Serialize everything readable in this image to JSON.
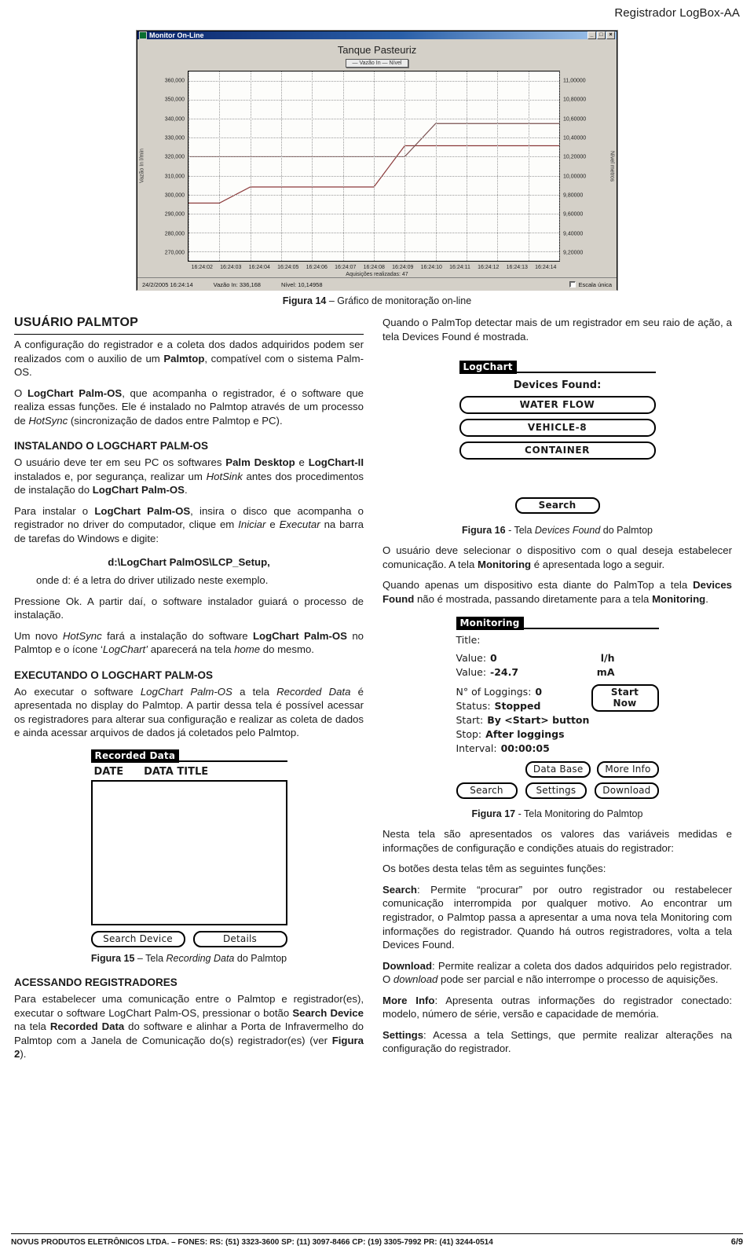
{
  "header": {
    "title": "Registrador LogBox-AA"
  },
  "window": {
    "title": "Monitor On-Line",
    "buttons": {
      "minimize": "_",
      "maximize": "□",
      "close": "×"
    },
    "chart_title": "Tanque Pasteuriz",
    "legend": "— Vazão In — Nível",
    "acquisitions": "Aquisições realizadas: 47",
    "status": {
      "datetime": "24/2/2005 16:24:14",
      "vazao": "Vazão In: 336,168",
      "nivel": "Nível: 10,14958",
      "checkbox_label": "Escala única"
    }
  },
  "chart_data": {
    "type": "line",
    "title": "Tanque Pasteuriz",
    "xlabel": "",
    "ylabel": "Vazão In l/min",
    "y2label": "Nível metros",
    "legend": [
      "Vazão In",
      "Nível"
    ],
    "legend_position": "top-center",
    "grid": true,
    "ylim": [
      265000,
      365000
    ],
    "y2lim": [
      9.1,
      11.1
    ],
    "yticks": [
      "360,000",
      "350,000",
      "340,000",
      "330,000",
      "320,000",
      "310,000",
      "300,000",
      "290,000",
      "280,000",
      "270,000"
    ],
    "ytick_values": [
      360000,
      350000,
      340000,
      330000,
      320000,
      310000,
      300000,
      290000,
      280000,
      270000
    ],
    "y2ticks": [
      "11,00000",
      "10,80000",
      "10,60000",
      "10,40000",
      "10,20000",
      "10,00000",
      "9,80000",
      "9,60000",
      "9,40000",
      "9,20000"
    ],
    "y2tick_values": [
      11.0,
      10.8,
      10.6,
      10.4,
      10.2,
      10.0,
      9.8,
      9.6,
      9.4,
      9.2
    ],
    "x": [
      "16:24:02",
      "16:24:03",
      "16:24:04",
      "16:24:05",
      "16:24:06",
      "16:24:07",
      "16:24:08",
      "16:24:09",
      "16:24:10",
      "16:24:11",
      "16:24:12",
      "16:24:13",
      "16:24:14"
    ],
    "series": [
      {
        "name": "Vazão In",
        "axis": "left",
        "color": "#8b3a3a",
        "values": [
          295500,
          295500,
          304000,
          304000,
          304000,
          304000,
          304000,
          325800,
          325800,
          325800,
          325800,
          325800,
          325800
        ]
      },
      {
        "name": "Nível",
        "axis": "right",
        "color": "#7a5050",
        "values": [
          10.2,
          10.2,
          10.2,
          10.2,
          10.2,
          10.2,
          10.2,
          10.2,
          10.55,
          10.55,
          10.55,
          10.55,
          10.55
        ]
      }
    ]
  },
  "captions": {
    "fig14": {
      "bold": "Figura 14",
      "rest": " – Gráfico de monitoração on-line"
    },
    "fig15": {
      "bold": "Figura 15",
      "rest": " – Tela Recording Data do Palmtop",
      "italic": "Recording Data"
    },
    "fig16": {
      "bold": "Figura 16",
      "rest": " – Tela Devices Found do Palmtop"
    },
    "fig17": {
      "bold": "Figura 17",
      "rest": " - Tela Monitoring do Palmtop"
    }
  },
  "left_column": {
    "heading": "USUÁRIO PALMTOP",
    "p1_a": "A configuração do registrador e a coleta dos dados adquiridos podem ser realizados com o auxilio de um ",
    "p1_b": "Palmtop",
    "p1_c": ", compatível com o sistema Palm-OS.",
    "p2_a": "O ",
    "p2_b": "LogChart Palm-OS",
    "p2_c": ", que acompanha o registrador, é o software que realiza essas funções. Ele é instalado no Palmtop através de um processo de ",
    "p2_d": "HotSync",
    "p2_e": " (sincronização de dados entre Palmtop e PC).",
    "sub1": "INSTALANDO O LOGCHART PALM-OS",
    "p3_a": "O usuário deve ter em seu PC os softwares ",
    "p3_b": "Palm Desktop",
    "p3_c": " e ",
    "p3_d": "LogChart-II",
    "p3_e": " instalados e, por segurança, realizar um ",
    "p3_f": "HotSink",
    "p3_g": " antes dos procedimentos de instalação do ",
    "p3_h": "LogChart Palm-OS",
    "p3_i": ".",
    "p4_a": "Para instalar o ",
    "p4_b": "LogChart Palm-OS",
    "p4_c": ", insira o disco que acompanha o registrador no driver do computador, clique em ",
    "p4_d": "Iniciar",
    "p4_e": " e ",
    "p4_f": "Executar",
    "p4_g": " na barra de tarefas do Windows e digite:",
    "path": "d:\\LogChart PalmOS\\LCP_Setup,",
    "p5": "onde d: é a letra do driver utilizado neste exemplo.",
    "p6": "Pressione Ok. A partir daí, o software instalador guiará o processo de instalação.",
    "p7_a": "Um novo ",
    "p7_b": "HotSync",
    "p7_c": " fará a instalação do software ",
    "p7_d": "LogChart Palm-OS",
    "p7_e": " no Palmtop e o ícone ‘",
    "p7_f": "LogChart’",
    "p7_g": " aparecerá na tela ",
    "p7_h": "home",
    "p7_i": " do mesmo.",
    "sub2": "EXECUTANDO O LOGCHART PALM-OS",
    "p8_a": "Ao executar o software ",
    "p8_b": "LogChart Palm-OS",
    "p8_c": " a tela ",
    "p8_d": "Recorded Data",
    "p8_e": " é apresentada no display do Palmtop. A partir dessa tela é possível acessar os registradores para alterar sua configuração e realizar as coleta de dados e ainda acessar arquivos de dados já coletados pelo Palmtop.",
    "sub3": "ACESSANDO REGISTRADORES",
    "p9_a": "Para estabelecer uma comunicação entre o Palmtop e registrador(es), executar o software LogChart Palm-OS, pressionar o botão ",
    "p9_b": "Search Device",
    "p9_c": " na tela ",
    "p9_d": "Recorded Data",
    "p9_e": " do software e alinhar a Porta de Infravermelho do Palmtop com a Janela de Comunicação do(s) registrador(es) (ver ",
    "p9_f": "Figura 2",
    "p9_g": ")."
  },
  "recorded_data_screen": {
    "title": "Recorded Data",
    "col_date": "DATE",
    "col_title": "DATA TITLE",
    "btn_search_device": "Search Device",
    "btn_details": "Details"
  },
  "devices_found_screen": {
    "title": "LogChart",
    "label": "Devices Found:",
    "devices": [
      "WATER FLOW",
      "VEHICLE-8",
      "CONTAINER"
    ],
    "btn_search": "Search"
  },
  "monitoring_screen": {
    "title": "Monitoring",
    "title_label": "Title:",
    "value1_label": "Value:",
    "value1": "0",
    "unit1": "l/h",
    "value2_label": "Value:",
    "value2": "-24.7",
    "unit2": "mA",
    "loggings_label": "N° of Loggings:",
    "loggings": "0",
    "status_label": "Status:",
    "status": "Stopped",
    "start_label": "Start:",
    "start": "By <Start> button",
    "stop_label": "Stop:",
    "stop": "After loggings",
    "interval_label": "Interval:",
    "interval": "00:00:05",
    "btn_start_now": "Start Now",
    "btn_data_base": "Data Base",
    "btn_more_info": "More Info",
    "btn_search": "Search",
    "btn_settings": "Settings",
    "btn_download": "Download"
  },
  "right_column": {
    "p1": "Quando o PalmTop detectar mais de um registrador em seu raio de ação, a tela Devices Found é mostrada.",
    "p2_a": "O usuário deve selecionar o dispositivo com o qual deseja estabelecer comunicação. A tela ",
    "p2_b": "Monitoring",
    "p2_c": " é apresentada logo a seguir.",
    "p3_a": "Quando apenas um dispositivo esta diante do PalmTop a tela ",
    "p3_b": "Devices Found",
    "p3_c": " não é mostrada, passando diretamente para a tela ",
    "p3_d": "Monitoring",
    "p3_e": ".",
    "p4": "Nesta tela são apresentados os valores das variáveis medidas e informações de configuração e condições atuais do registrador:",
    "p5": "Os botões desta telas têm as seguintes funções:",
    "p6_a": "Search",
    "p6_b": ": Permite “procurar” por outro registrador ou restabelecer comunicação interrompida por qualquer motivo. Ao encontrar um registrador, o Palmtop passa a apresentar a uma nova tela Monitoring com informações do registrador. Quando há outros registradores, volta a tela Devices Found.",
    "p7_a": "Download",
    "p7_b": ": Permite realizar a coleta dos dados adquiridos pelo registrador. O ",
    "p7_c": "download",
    "p7_d": " pode ser parcial e não interrompe o processo de aquisições.",
    "p8_a": "More Info",
    "p8_b": ": Apresenta outras informações do registrador conectado: modelo, número de série, versão e capacidade de memória.",
    "p9_a": "Settings",
    "p9_b": ": Acessa a tela Settings, que permite realizar alterações na configuração do registrador."
  },
  "footer": {
    "text": "NOVUS PRODUTOS ELETRÔNICOS LTDA. – FONES: RS: (51) 3323-3600  SP: (11) 3097-8466  CP: (19) 3305-7992  PR: (41) 3244-0514",
    "page": "6/9"
  }
}
